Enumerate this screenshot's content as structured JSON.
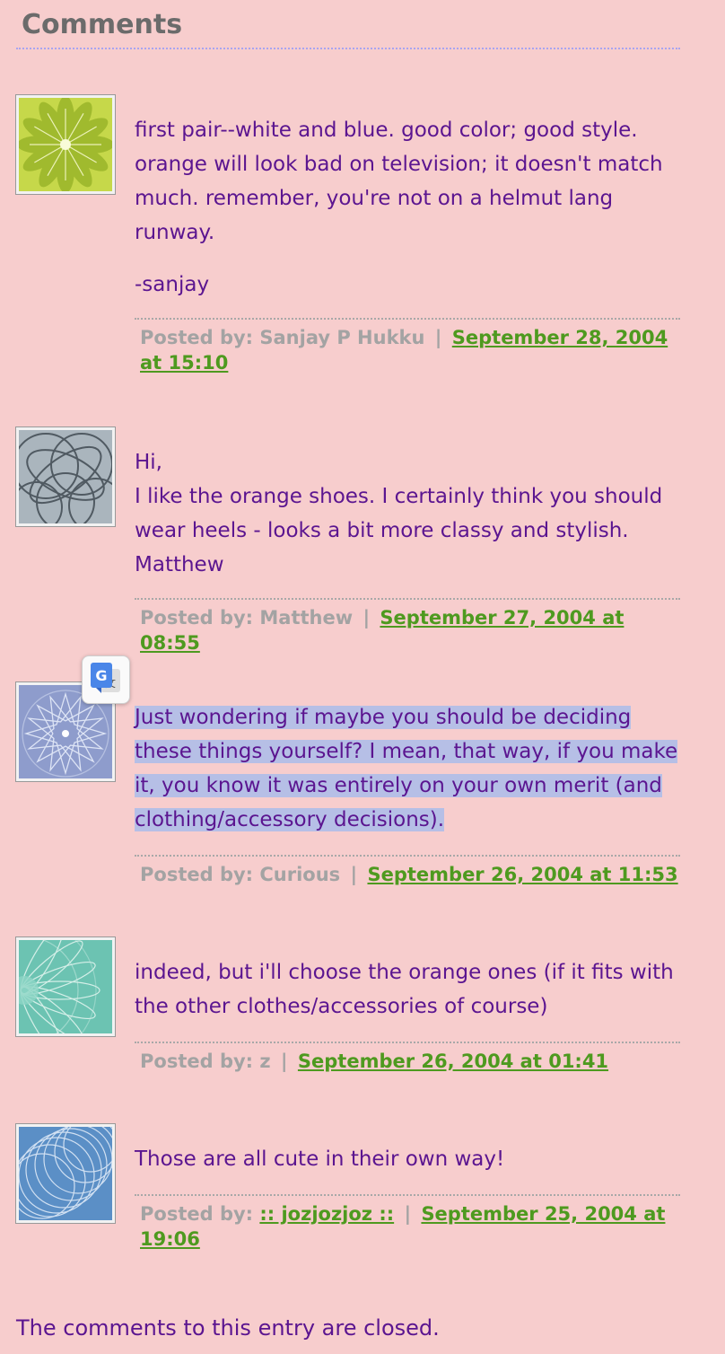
{
  "heading": "Comments",
  "posted_by_label": "Posted by:",
  "separator": "|",
  "comments": [
    {
      "avatar": "flower-avatar-icon",
      "paragraphs": [
        "first pair--white and blue. good color; good style. orange will look bad on television; it doesn't match much. remember, you're not on a helmut lang runway.",
        "-sanjay"
      ],
      "author": "Sanjay P Hukku",
      "date": "September 28, 2004 at 15:10"
    },
    {
      "avatar": "spirograph-avatar-icon",
      "lines": [
        "Hi,",
        "I like the orange shoes. I certainly think you should wear heels - looks a bit more classy and stylish.",
        "Matthew"
      ],
      "author": "Matthew",
      "date": "September 27, 2004 at 08:55"
    },
    {
      "avatar": "star-avatar-icon",
      "text": "Just wondering if maybe you should be deciding these things yourself? I mean, that way, if you make it, you know it was entirely on your own merit (and clothing/accessory decisions).",
      "author": "Curious",
      "date": "September 26, 2004 at 11:53"
    },
    {
      "avatar": "teal-fan-avatar-icon",
      "text": "indeed, but i'll choose the orange ones (if it fits with the other clothes/accessories of course)",
      "author": "z",
      "date": "September 26, 2004 at 01:41"
    },
    {
      "avatar": "blue-circles-avatar-icon",
      "text": "Those are all cute in their own way!",
      "author": ":: jozjozjoz ::",
      "date": "September 25, 2004 at 19:06"
    }
  ],
  "translate_badge": "google-translate-icon",
  "closed_notice": "The comments to this entry are closed."
}
